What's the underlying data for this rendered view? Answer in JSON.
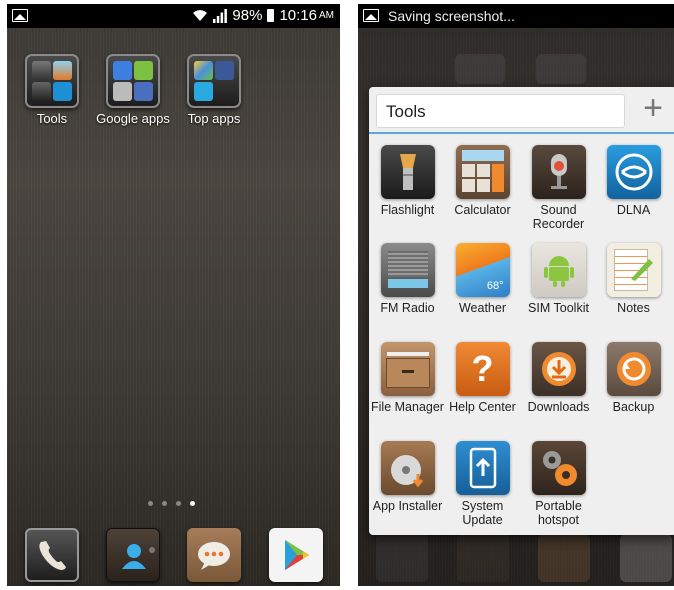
{
  "left_screen": {
    "status": {
      "battery": "98%",
      "time": "10:16",
      "ampm": "AM"
    },
    "folders": [
      {
        "label": "Tools"
      },
      {
        "label": "Google apps"
      },
      {
        "label": "Top apps"
      }
    ],
    "page_indicator": {
      "count": 4,
      "active": 4
    },
    "dock": [
      "phone-icon",
      "contacts-icon",
      "messaging-icon",
      "play-store-icon"
    ]
  },
  "right_screen": {
    "status": {
      "notification": "Saving screenshot..."
    },
    "folder_dialog": {
      "title": "Tools",
      "add_symbol": "+",
      "apps": [
        {
          "label": "Flashlight"
        },
        {
          "label": "Calculator"
        },
        {
          "label": "Sound Recorder"
        },
        {
          "label": "DLNA"
        },
        {
          "label": "FM Radio"
        },
        {
          "label": "Weather",
          "temp": "68°"
        },
        {
          "label": "SIM Toolkit"
        },
        {
          "label": "Notes"
        },
        {
          "label": "File Manager"
        },
        {
          "label": "Help Center",
          "glyph": "?"
        },
        {
          "label": "Downloads"
        },
        {
          "label": "Backup"
        },
        {
          "label": "App Installer"
        },
        {
          "label": "System Update"
        },
        {
          "label": "Portable hotspot"
        }
      ]
    }
  },
  "colors": {
    "accent": "#5aa7d8",
    "panel_bg": "#efefef"
  }
}
